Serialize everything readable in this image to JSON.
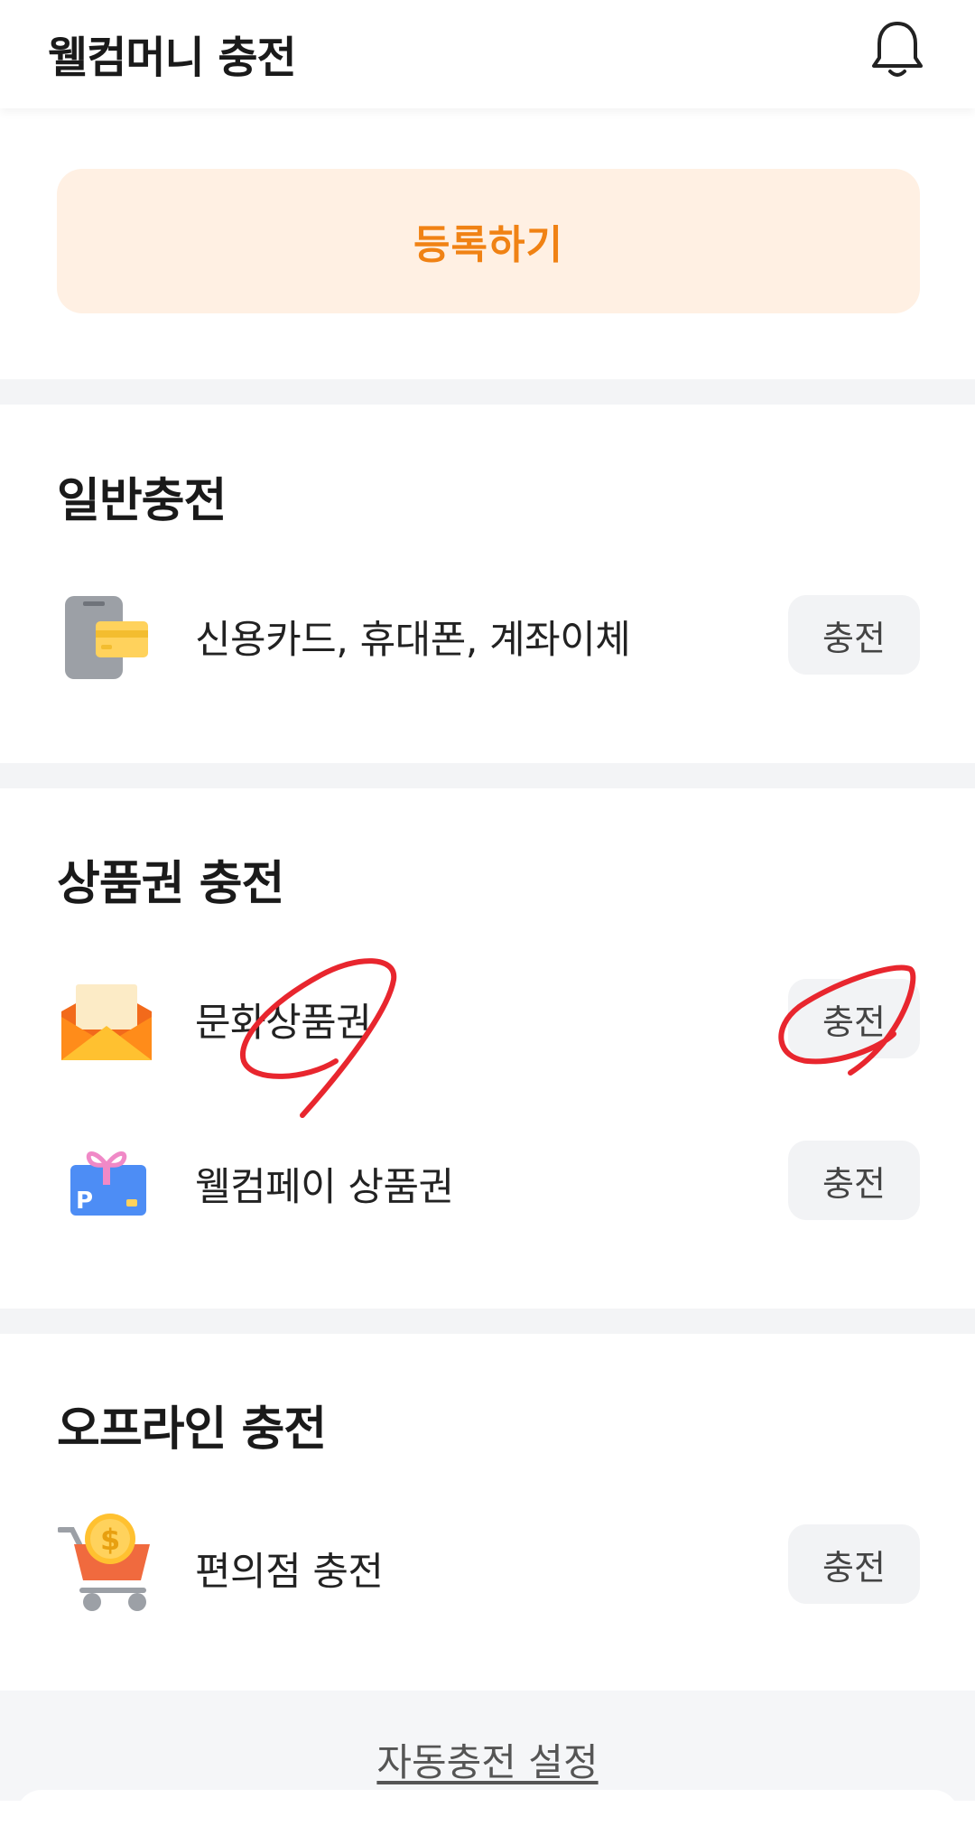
{
  "header": {
    "title": "웰컴머니 충전"
  },
  "register": {
    "label": "등록하기"
  },
  "sections": [
    {
      "title": "일반충전",
      "items": [
        {
          "label": "신용카드, 휴대폰, 계좌이체",
          "button": "충전",
          "icon": "card-phone-icon"
        }
      ]
    },
    {
      "title": "상품권 충전",
      "items": [
        {
          "label": "문화상품권",
          "button": "충전",
          "icon": "envelope-icon"
        },
        {
          "label": "웰컴페이 상품권",
          "button": "충전",
          "icon": "gift-card-icon"
        }
      ]
    },
    {
      "title": "오프라인 충전",
      "items": [
        {
          "label": "편의점 충전",
          "button": "충전",
          "icon": "shopping-cart-coin-icon"
        }
      ]
    }
  ],
  "footer": {
    "auto_charge_link": "자동충전 설정"
  },
  "colors": {
    "accent": "#f08214",
    "register_bg": "#fff0e3",
    "annotation": "#e8262e"
  }
}
